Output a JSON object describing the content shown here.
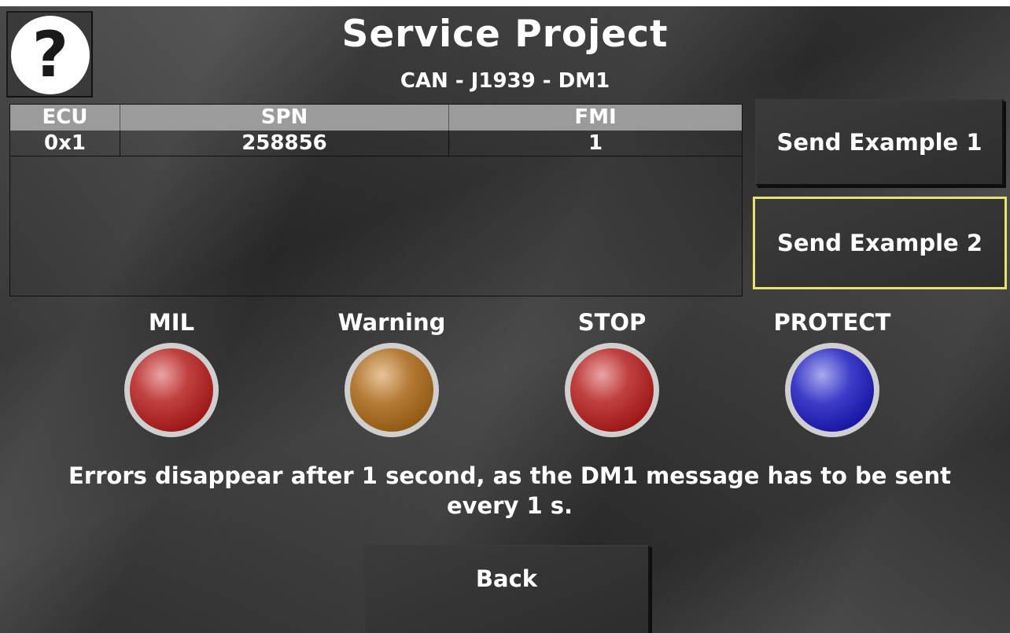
{
  "header": {
    "title": "Service Project",
    "subtitle": "CAN - J1939 - DM1",
    "help_symbol": "?"
  },
  "table": {
    "columns": [
      "ECU",
      "SPN",
      "FMI"
    ],
    "rows": [
      {
        "ecu": "0x1",
        "spn": "258856",
        "fmi": "1"
      }
    ]
  },
  "buttons": {
    "send_example_1": "Send Example 1",
    "send_example_2": "Send Example 2",
    "back": "Back"
  },
  "lamps": [
    {
      "label": "MIL",
      "color": "#b01818"
    },
    {
      "label": "Warning",
      "color": "#a86a20"
    },
    {
      "label": "STOP",
      "color": "#b01818"
    },
    {
      "label": "PROTECT",
      "color": "#1818b0"
    }
  ],
  "note": {
    "line1": "Errors disappear after 1 second, as the DM1 message has to be sent",
    "line2": "every 1 s."
  },
  "accent": {
    "focus_border": "#e8e36a"
  }
}
